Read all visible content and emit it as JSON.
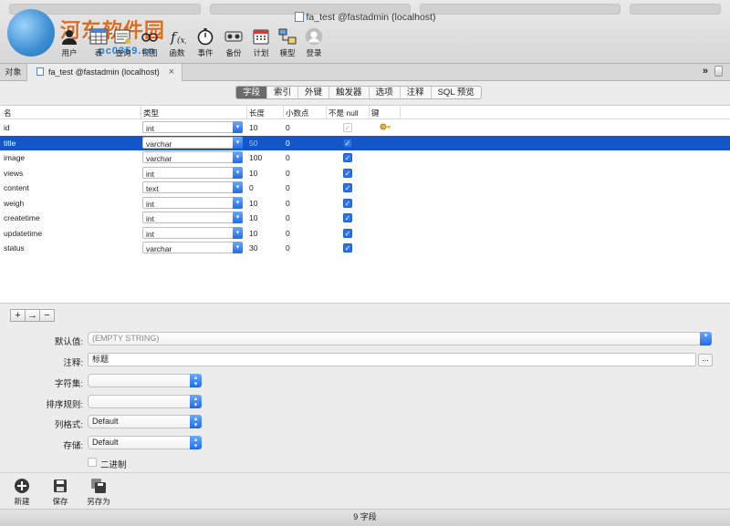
{
  "window": {
    "title": "fa_test @fastadmin (localhost)"
  },
  "watermark": {
    "name": "河东软件园",
    "url": "pc0359.cn"
  },
  "toolbar": {
    "items": [
      {
        "label": "用户",
        "icon": "users-icon"
      },
      {
        "label": "表",
        "icon": "table-icon"
      },
      {
        "label": "查询",
        "icon": "query-icon"
      },
      {
        "label": "视图",
        "icon": "view-icon"
      },
      {
        "label": "函数",
        "icon": "function-icon"
      },
      {
        "label": "事件",
        "icon": "stopwatch-icon"
      },
      {
        "label": "备份",
        "icon": "backup-icon"
      },
      {
        "label": "计划",
        "icon": "calendar-icon"
      },
      {
        "label": "模型",
        "icon": "model-icon"
      },
      {
        "label": "登录",
        "icon": "user-login-icon"
      }
    ]
  },
  "tabs": {
    "objects": "对象",
    "doc": "fa_test @fastadmin (localhost)",
    "more": "»"
  },
  "segments": [
    "字段",
    "索引",
    "外键",
    "触发器",
    "选项",
    "注释",
    "SQL 预览"
  ],
  "table": {
    "headers": [
      "名",
      "类型",
      "长度",
      "小数点",
      "不是 null",
      "键"
    ],
    "rows": [
      {
        "name": "id",
        "type": "int",
        "length": "10",
        "decimals": "0",
        "not_null": true,
        "key": true,
        "selected": false
      },
      {
        "name": "title",
        "type": "varchar",
        "length": "50",
        "decimals": "0",
        "not_null": true,
        "key": false,
        "selected": true
      },
      {
        "name": "image",
        "type": "varchar",
        "length": "100",
        "decimals": "0",
        "not_null": true,
        "key": false,
        "selected": false
      },
      {
        "name": "views",
        "type": "int",
        "length": "10",
        "decimals": "0",
        "not_null": true,
        "key": false,
        "selected": false
      },
      {
        "name": "content",
        "type": "text",
        "length": "0",
        "decimals": "0",
        "not_null": true,
        "key": false,
        "selected": false
      },
      {
        "name": "weigh",
        "type": "int",
        "length": "10",
        "decimals": "0",
        "not_null": true,
        "key": false,
        "selected": false
      },
      {
        "name": "createtime",
        "type": "int",
        "length": "10",
        "decimals": "0",
        "not_null": true,
        "key": false,
        "selected": false
      },
      {
        "name": "updatetime",
        "type": "int",
        "length": "10",
        "decimals": "0",
        "not_null": true,
        "key": false,
        "selected": false
      },
      {
        "name": "status",
        "type": "varchar",
        "length": "30",
        "decimals": "0",
        "not_null": true,
        "key": false,
        "selected": false
      }
    ]
  },
  "actions": {
    "add": "+",
    "insert": "→",
    "remove": "−"
  },
  "props": {
    "default_label": "默认值:",
    "default_value": "(EMPTY STRING)",
    "comment_label": "注释:",
    "comment_value": "标题",
    "ellipsis": "...",
    "charset_label": "字符集:",
    "charset_value": "",
    "collation_label": "排序规则:",
    "collation_value": "",
    "format_label": "列格式:",
    "format_value": "Default",
    "storage_label": "存储:",
    "storage_value": "Default",
    "binary_label": "二进制"
  },
  "bottom": {
    "new": "新建",
    "save": "保存",
    "save_as": "另存为"
  },
  "status": "9 字段"
}
